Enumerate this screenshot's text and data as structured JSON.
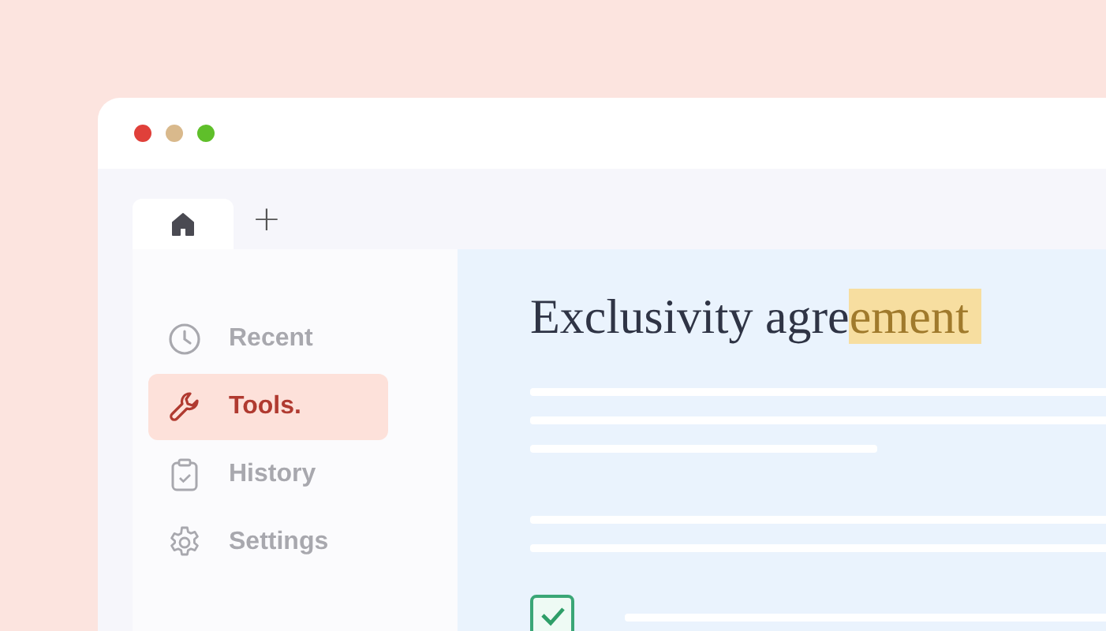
{
  "window": {
    "controls": [
      {
        "kind": "close"
      },
      {
        "kind": "minimize"
      },
      {
        "kind": "maximize"
      }
    ]
  },
  "tabs": [
    {
      "kind": "home",
      "selected": true
    },
    {
      "kind": "add",
      "label": "+",
      "selected": false
    }
  ],
  "sidebar": {
    "items": [
      {
        "kind": "clock",
        "label": "Recent",
        "selected": false
      },
      {
        "kind": "wrench",
        "label": "Tools.",
        "selected": true
      },
      {
        "kind": "clipboard",
        "label": "History",
        "selected": false
      },
      {
        "kind": "gear",
        "label": "Settings",
        "selected": false
      }
    ]
  },
  "document": {
    "title_parts": [
      {
        "text": "Exclusivity agre",
        "highlighted": false
      },
      {
        "text": "ement",
        "highlighted": true
      }
    ],
    "task": {
      "checked": true
    }
  }
}
